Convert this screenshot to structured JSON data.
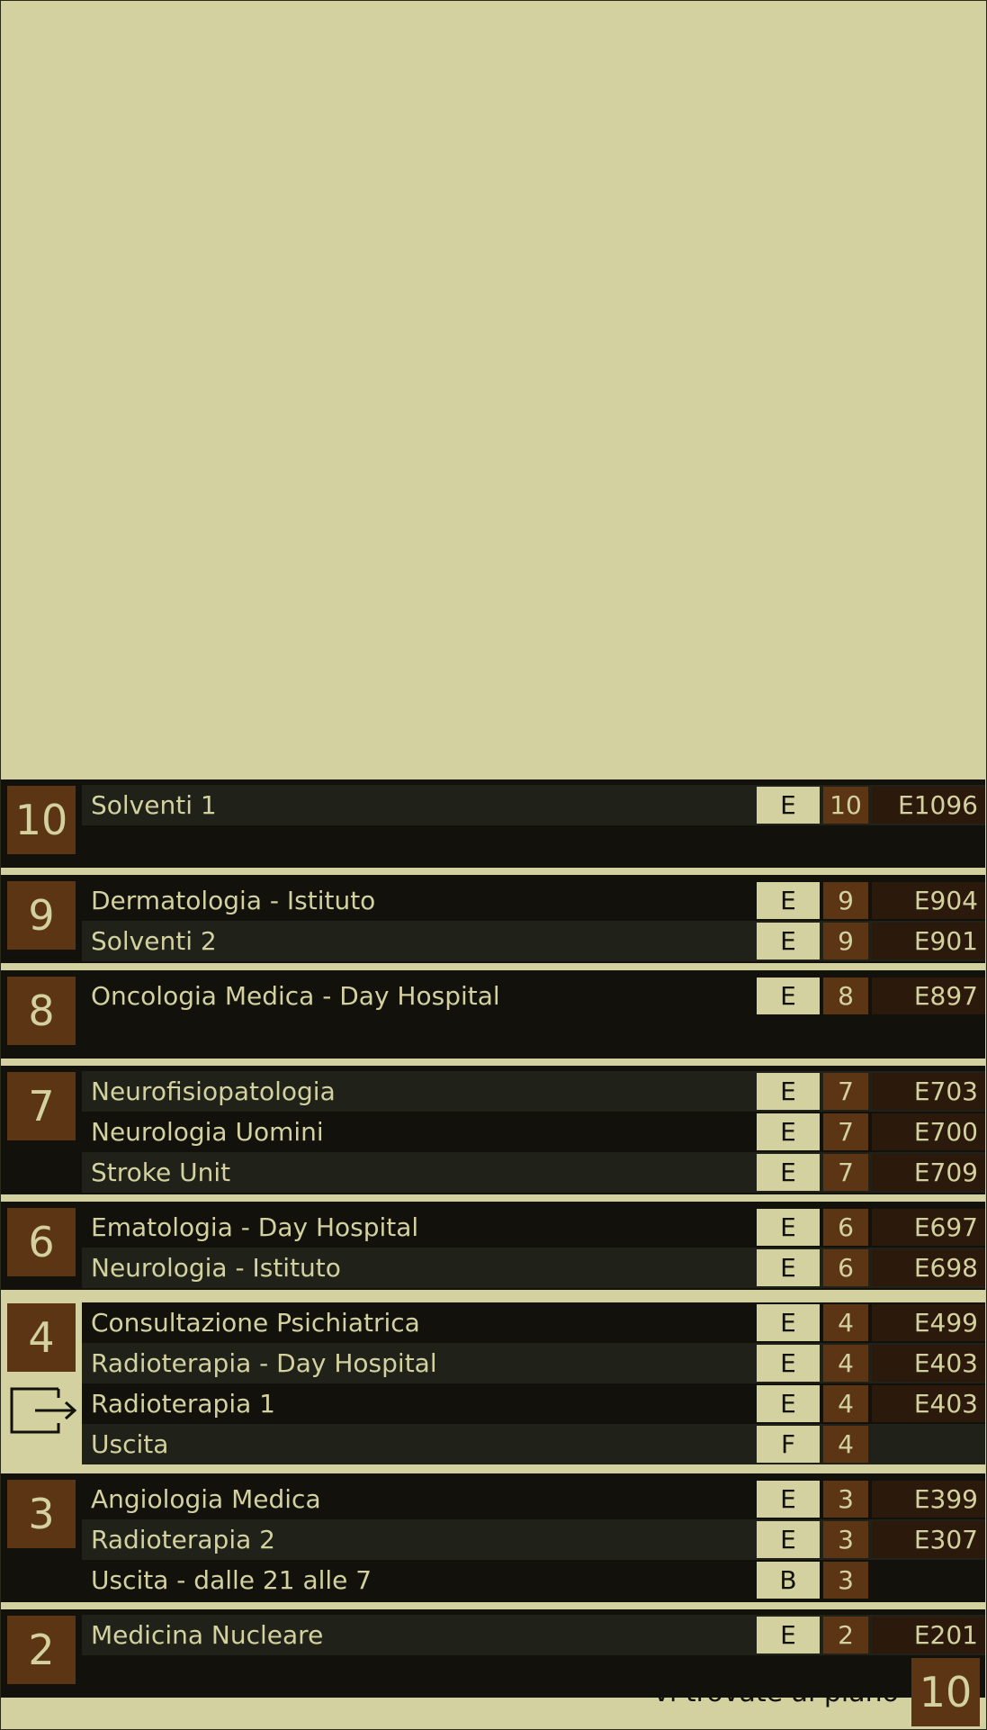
{
  "floors": [
    {
      "number": "10",
      "rows": [
        {
          "name": "Solventi 1",
          "building": "E",
          "floor": "10",
          "room": "E1096"
        }
      ]
    },
    {
      "number": "9",
      "rows": [
        {
          "name": "Dermatologia - Istituto",
          "building": "E",
          "floor": "9",
          "room": "E904"
        },
        {
          "name": "Solventi 2",
          "building": "E",
          "floor": "9",
          "room": "E901"
        }
      ]
    },
    {
      "number": "8",
      "rows": [
        {
          "name": "Oncologia Medica - Day Hospital",
          "building": "E",
          "floor": "8",
          "room": "E897"
        }
      ]
    },
    {
      "number": "7",
      "rows": [
        {
          "name": "Neurofisiopatologia",
          "building": "E",
          "floor": "7",
          "room": "E703"
        },
        {
          "name": "Neurologia Uomini",
          "building": "E",
          "floor": "7",
          "room": "E700"
        },
        {
          "name": "Stroke Unit",
          "building": "E",
          "floor": "7",
          "room": "E709"
        }
      ]
    },
    {
      "number": "6",
      "rows": [
        {
          "name": "Ematologia - Day Hospital",
          "building": "E",
          "floor": "6",
          "room": "E697"
        },
        {
          "name": "Neurologia - Istituto",
          "building": "E",
          "floor": "6",
          "room": "E698"
        }
      ]
    },
    {
      "number": "4",
      "rows": [
        {
          "name": "Consultazione Psichiatrica",
          "building": "E",
          "floor": "4",
          "room": "E499"
        },
        {
          "name": "Radioterapia - Day Hospital",
          "building": "E",
          "floor": "4",
          "room": "E403"
        },
        {
          "name": "Radioterapia 1",
          "building": "E",
          "floor": "4",
          "room": "E403"
        },
        {
          "name": "Uscita",
          "building": "F",
          "floor": "4",
          "room": ""
        }
      ]
    },
    {
      "number": "3",
      "rows": [
        {
          "name": "Angiologia Medica",
          "building": "E",
          "floor": "3",
          "room": "E399"
        },
        {
          "name": "Radioterapia 2",
          "building": "E",
          "floor": "3",
          "room": "E307"
        },
        {
          "name": "Uscita - dalle 21 alle 7",
          "building": "B",
          "floor": "3",
          "room": ""
        }
      ]
    },
    {
      "number": "2",
      "rows": [
        {
          "name": "Medicina Nucleare",
          "building": "E",
          "floor": "2",
          "room": "E201"
        }
      ]
    }
  ],
  "footer": {
    "label": "vi trovate al piano",
    "current_floor": "10"
  },
  "icons": {
    "exit": "exit-arrow-icon"
  },
  "colors": {
    "background": "#d3d19f",
    "dark": "#12110c",
    "row_alt": "#20221a",
    "brown": "#5c3514",
    "room_brown": "#2b1a0c"
  }
}
